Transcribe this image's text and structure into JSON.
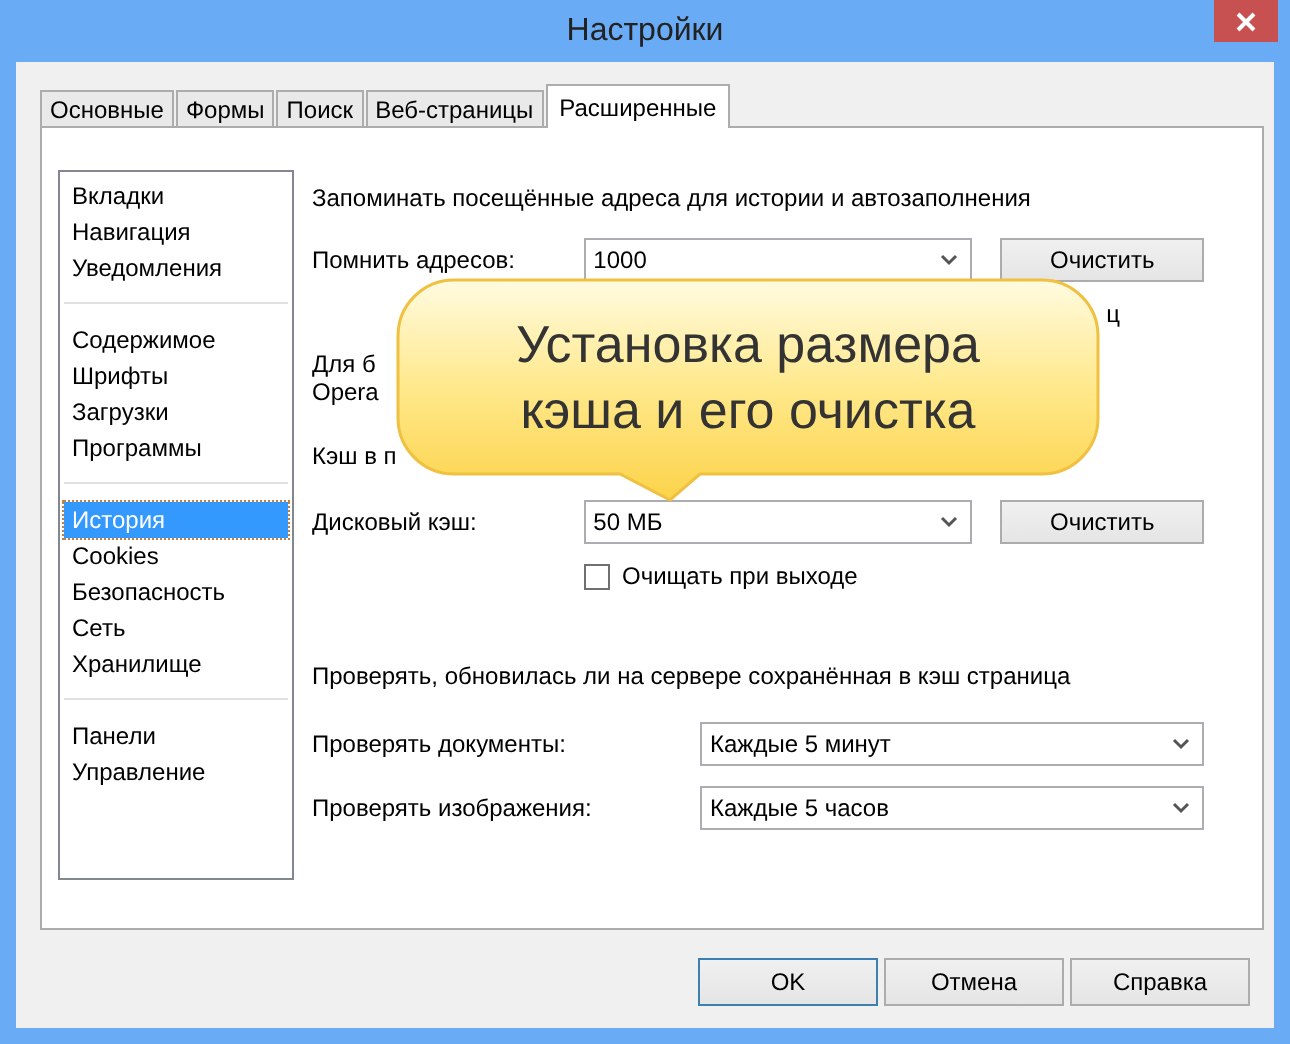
{
  "window": {
    "title": "Настройки"
  },
  "tabs": [
    {
      "label": "Основные",
      "selected": false
    },
    {
      "label": "Формы",
      "selected": false
    },
    {
      "label": "Поиск",
      "selected": false
    },
    {
      "label": "Веб-страницы",
      "selected": false
    },
    {
      "label": "Расширенные",
      "selected": true
    }
  ],
  "sidebar": {
    "groups": [
      {
        "items": [
          {
            "label": "Вкладки",
            "selected": false
          },
          {
            "label": "Навигация",
            "selected": false
          },
          {
            "label": "Уведомления",
            "selected": false
          }
        ]
      },
      {
        "items": [
          {
            "label": "Содержимое",
            "selected": false
          },
          {
            "label": "Шрифты",
            "selected": false
          },
          {
            "label": "Загрузки",
            "selected": false
          },
          {
            "label": "Программы",
            "selected": false
          }
        ]
      },
      {
        "items": [
          {
            "label": "История",
            "selected": true
          },
          {
            "label": "Cookies",
            "selected": false
          },
          {
            "label": "Безопасность",
            "selected": false
          },
          {
            "label": "Сеть",
            "selected": false
          },
          {
            "label": "Хранилище",
            "selected": false
          }
        ]
      },
      {
        "items": [
          {
            "label": "Панели",
            "selected": false
          },
          {
            "label": "Управление",
            "selected": false
          }
        ]
      }
    ]
  },
  "history": {
    "heading": "Запоминать посещённые адреса для истории и автозаполнения",
    "remember": {
      "label": "Помнить адресов:",
      "value": "1000",
      "button": "Очистить"
    },
    "fragment": "ц",
    "note_line_1": "Для б",
    "note_line_2": "Opera",
    "cache_label": "Кэш в п",
    "disk_cache": {
      "label": "Дисковый кэш:",
      "value": "50 МБ",
      "button": "Очистить"
    },
    "clear_on_exit": {
      "label": "Очищать при выходе",
      "checked": false
    }
  },
  "check": {
    "heading": "Проверять, обновилась ли на сервере сохранённая в кэш страница",
    "rows": [
      {
        "label": "Проверять документы:",
        "value": "Каждые 5 минут"
      },
      {
        "label": "Проверять изображения:",
        "value": "Каждые 5 часов"
      }
    ]
  },
  "callout": {
    "lines": [
      "Установка размера",
      "кэша и его очистка"
    ]
  },
  "buttons": [
    {
      "label": "OK",
      "default": true
    },
    {
      "label": "Отмена",
      "default": false
    },
    {
      "label": "Справка",
      "default": false
    }
  ]
}
